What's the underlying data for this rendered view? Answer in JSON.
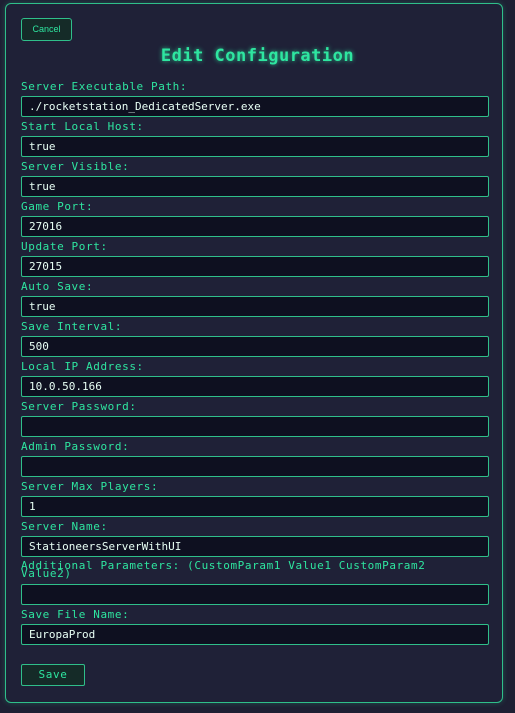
{
  "header": {
    "cancel_label": "Cancel",
    "title": "Edit Configuration"
  },
  "fields": {
    "exe_path": {
      "label": "Server Executable Path:",
      "value": "./rocketstation_DedicatedServer.exe"
    },
    "start_local_host": {
      "label": "Start Local Host:",
      "value": "true"
    },
    "server_visible": {
      "label": "Server Visible:",
      "value": "true"
    },
    "game_port": {
      "label": "Game Port:",
      "value": "27016"
    },
    "update_port": {
      "label": "Update Port:",
      "value": "27015"
    },
    "auto_save": {
      "label": "Auto Save:",
      "value": "true"
    },
    "save_interval": {
      "label": "Save Interval:",
      "value": "500"
    },
    "local_ip": {
      "label": "Local IP Address:",
      "value": "10.0.50.166"
    },
    "server_password": {
      "label": "Server Password:",
      "value": ""
    },
    "admin_password": {
      "label": "Admin Password:",
      "value": ""
    },
    "max_players": {
      "label": "Server Max Players:",
      "value": "1"
    },
    "server_name": {
      "label": "Server Name:",
      "value": "StationeersServerWithUI"
    },
    "additional_params": {
      "label": "Additional Parameters: (CustomParam1 Value1 CustomParam2 Value2)",
      "value": ""
    },
    "save_file_name": {
      "label": "Save File Name:",
      "value": "EuropaProd"
    }
  },
  "footer": {
    "save_label": "Save"
  },
  "colors": {
    "accent": "#2ee6a0",
    "background": "#1e1f33",
    "input_background": "#0e1020"
  }
}
